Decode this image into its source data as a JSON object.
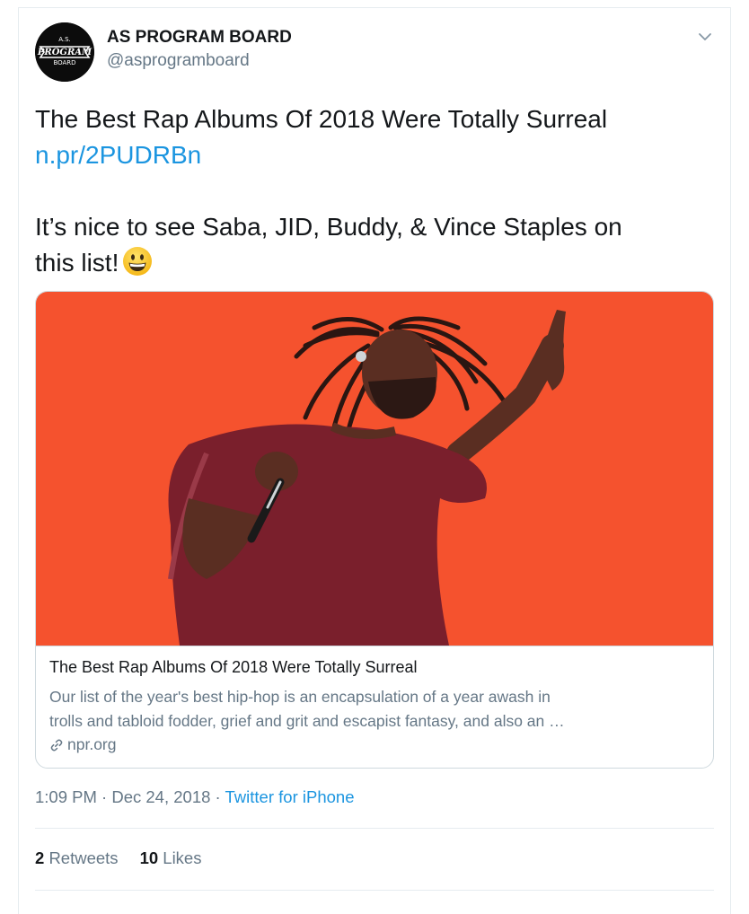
{
  "account": {
    "display_name": "AS PROGRAM BOARD",
    "handle": "@asprogramboard",
    "avatar_text_top": "A.S.",
    "avatar_text_mid": "PROGRAM",
    "avatar_text_bot": "BOARD"
  },
  "tweet": {
    "line1": "The Best Rap Albums Of 2018 Were Totally Surreal",
    "link": "n.pr/2PUDRBn",
    "line3": "It’s nice to see Saba, JID, Buddy, & Vince Staples on",
    "line4": "this list!",
    "emoji": "grinning-face"
  },
  "card": {
    "title": "The Best Rap Albums Of 2018 Were Totally Surreal",
    "description_line1": "Our list of the year's best hip-hop is an encapsulation of a year awash in",
    "description_line2": "trolls and tabloid fodder, grief and grit and escapist fantasy, and also an …",
    "domain": "npr.org"
  },
  "meta": {
    "time": "1:09 PM",
    "separator1": " · ",
    "date": "Dec 24, 2018",
    "separator2": " · ",
    "source": "Twitter for iPhone"
  },
  "stats": {
    "retweets_count": "2",
    "retweets_label": "Retweets",
    "likes_count": "10",
    "likes_label": "Likes"
  },
  "colors": {
    "link": "#1b95e0",
    "secondary_text": "#657786",
    "image_background": "#f24a2a"
  }
}
